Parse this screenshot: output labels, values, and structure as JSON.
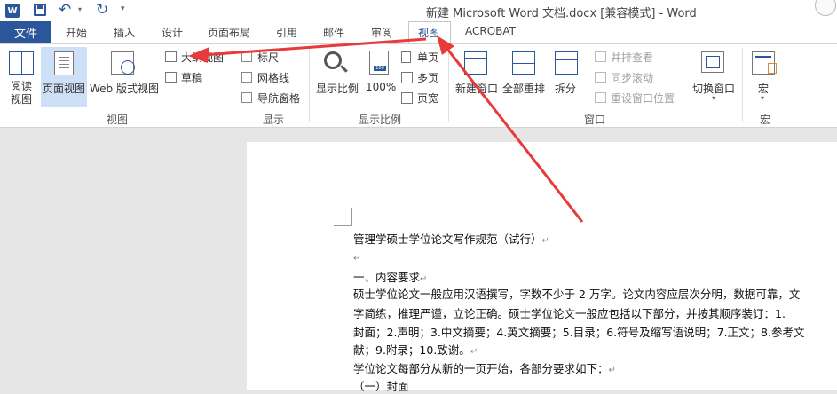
{
  "title_bar": {
    "app_icon": "W",
    "title": "新建 Microsoft Word 文档.docx [兼容模式] - Word",
    "icons": [
      "save-icon",
      "undo-icon",
      "redo-icon",
      "customize-icon"
    ]
  },
  "tabs": {
    "file": "文件",
    "home": "开始",
    "insert": "插入",
    "design": "设计",
    "layout": "页面布局",
    "references": "引用",
    "mailings": "邮件",
    "review": "审阅",
    "view": "视图",
    "acrobat": "ACROBAT"
  },
  "ribbon": {
    "views_group": {
      "label": "视图",
      "read_mode": "阅读\n视图",
      "print_layout": "页面视图",
      "web_layout": "Web 版式视图",
      "outline": "大纲视图",
      "draft": "草稿"
    },
    "show_group": {
      "label": "显示",
      "ruler": "标尺",
      "gridlines": "网格线",
      "nav_pane": "导航窗格"
    },
    "zoom_group": {
      "label": "显示比例",
      "zoom": "显示比例",
      "hundred": "100%",
      "one_page": "单页",
      "multi_page": "多页",
      "page_width": "页宽"
    },
    "window_group": {
      "label": "窗口",
      "new_window": "新建窗口",
      "arrange_all": "全部重排",
      "split": "拆分",
      "side_by_side": "并排查看",
      "sync_scroll": "同步滚动",
      "reset_pos": "重设窗口位置",
      "switch_windows": "切换窗口"
    },
    "macros_group": {
      "label": "宏",
      "macros": "宏"
    }
  },
  "document": {
    "lines": [
      "管理学硕士学位论文写作规范（试行）",
      "",
      "一、内容要求",
      "硕士学位论文一般应用汉语撰写，字数不少于 2 万字。论文内容应层次分明，数据可靠，文",
      "字简练，推理严谨，立论正确。硕士学位论文一般应包括以下部分，并按其顺序装订：1.",
      "封面；2.声明；3.中文摘要；4.英文摘要；5.目录；6.符号及缩写语说明；7.正文；8.参考文",
      "献；9.附录；10.致谢。",
      "学位论文每部分从新的一页开始，各部分要求如下：",
      "（一）封面"
    ],
    "paragraph_mark": "↵"
  },
  "colors": {
    "file_tab": "#2b579a",
    "arrow": "#e8393b"
  }
}
